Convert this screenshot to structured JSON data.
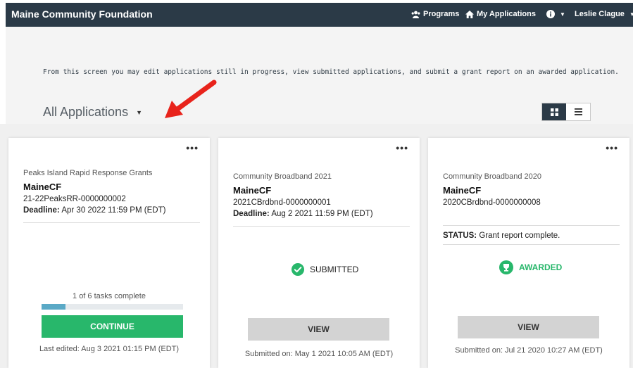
{
  "nav": {
    "brand": "Maine Community Foundation",
    "programs": "Programs",
    "my_applications": "My Applications",
    "user": "Leslie Clague",
    "icons": [
      "users-icon",
      "home-icon",
      "info-icon"
    ]
  },
  "header": {
    "intro": "From this screen you may edit applications still in progress, view submitted applications, and submit a grant report on an awarded application.",
    "title": "All Applications",
    "view_mode": "grid"
  },
  "colors": {
    "nav_bg": "#2b3a47",
    "continue_green": "#28b76b",
    "progress_blue": "#5aa9c6",
    "arrow_red": "#e8231b"
  },
  "cards": [
    {
      "program": "Peaks Island Rapid Response Grants",
      "org": "MaineCF",
      "code": "21-22PeaksRR-0000000002",
      "deadline_label": "Deadline:",
      "deadline": "Apr 30 2022 11:59 PM (EDT)",
      "progress_text": "1 of 6 tasks complete",
      "progress": 0.167,
      "button": "CONTINUE",
      "footer": "Last edited: Aug 3 2021 01:15 PM (EDT)"
    },
    {
      "program": "Community Broadband 2021",
      "org": "MaineCF",
      "code": "2021CBrdbnd-0000000001",
      "deadline_label": "Deadline:",
      "deadline": "Aug 2 2021 11:59 PM (EDT)",
      "status_badge": "SUBMITTED",
      "button": "VIEW",
      "footer": "Submitted on: May 1 2021 10:05 AM (EDT)"
    },
    {
      "program": "Community Broadband 2020",
      "org": "MaineCF",
      "code": "2020CBrdbnd-0000000008",
      "status_label": "STATUS:",
      "status_text": "Grant report complete.",
      "status_badge": "AWARDED",
      "button": "VIEW",
      "footer": "Submitted on: Jul 21 2020 10:27 AM (EDT)"
    }
  ]
}
